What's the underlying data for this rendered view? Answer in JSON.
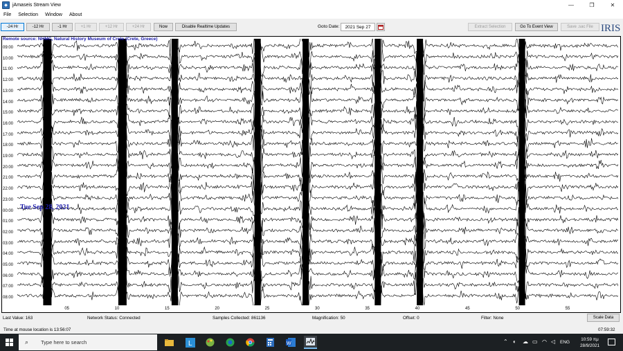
{
  "window": {
    "title": "jAmaseis Stream View",
    "min_glyph": "—",
    "max_glyph": "❐",
    "close_glyph": "✕"
  },
  "menu": [
    "File",
    "Selection",
    "Window",
    "About"
  ],
  "toolbar": {
    "buttons": [
      {
        "label": "-24 Hr",
        "state": "active"
      },
      {
        "label": "-12 Hr",
        "state": "normal"
      },
      {
        "label": "-1 Hr",
        "state": "normal"
      },
      {
        "label": "+1 Hr",
        "state": "disabled"
      },
      {
        "label": "+12 Hr",
        "state": "disabled"
      },
      {
        "label": "+24 Hr",
        "state": "disabled"
      },
      {
        "label": "Now",
        "state": "normal"
      },
      {
        "label": "Disable Realtime Updates",
        "state": "normal"
      }
    ],
    "goto_label": "Goto Date:",
    "goto_value": "2021 Sep 27",
    "right_buttons": [
      {
        "label": "Extract Selection",
        "state": "disabled"
      },
      {
        "label": "Go To Event View",
        "state": "normal"
      },
      {
        "label": "Save .sac File",
        "state": "disabled"
      }
    ],
    "logo": "IRIS"
  },
  "plot": {
    "source": "Remote source: NHMC, Natural History Museum of Crete (Crete, Greece)",
    "hours": [
      "09:00",
      "10:00",
      "11:00",
      "12:00",
      "13:00",
      "14:00",
      "15:00",
      "16:00",
      "17:00",
      "18:00",
      "19:00",
      "20:00",
      "21:00",
      "22:00",
      "23:00",
      "00:00",
      "01:00",
      "02:00",
      "03:00",
      "04:00",
      "05:00",
      "06:00",
      "07:00",
      "08:00"
    ],
    "minute_ticks": [
      "05",
      "10",
      "15",
      "20",
      "25",
      "30",
      "35",
      "40",
      "45",
      "50",
      "55"
    ],
    "date_annotation": "Tue Sep 28, 2021",
    "colors": {
      "trace": "#000000",
      "annotation": "#1c1ca8"
    }
  },
  "status": {
    "last_value": "Last Value:   163",
    "network": "Network Status:  Connected",
    "samples": "Samples Collected:  861136",
    "magnification": "Magnification:  50",
    "offset": "Offset:  0",
    "filter": "Filter:  None",
    "scale_button": "Scale Data",
    "mouse_time": "Time at mouse location is 13:56:07",
    "utc_clock": "07:59:32"
  },
  "taskbar": {
    "search_placeholder": "Type here to search",
    "lang": "ENG",
    "time": "10:59 πμ",
    "date": "28/9/2021"
  }
}
